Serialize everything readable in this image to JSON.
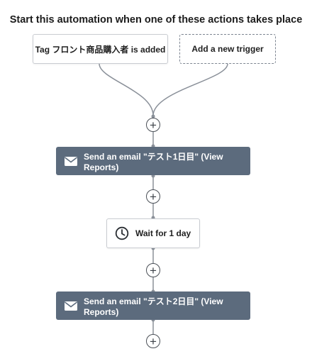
{
  "heading": "Start this automation when one of these actions takes place",
  "triggers": {
    "existing_label": "Tag フロント商品購入者 is added",
    "add_label": "Add a new trigger"
  },
  "steps": [
    {
      "type": "email",
      "icon": "envelope-icon",
      "label": "Send an email \"テスト1日目\" (View Reports)"
    },
    {
      "type": "wait",
      "icon": "clock-icon",
      "label": "Wait for 1 day"
    },
    {
      "type": "email",
      "icon": "envelope-icon",
      "label": "Send an email \"テスト2日目\" (View Reports)"
    }
  ],
  "add_step_symbol": "+",
  "colors": {
    "email_step_bg": "#5c6b7d",
    "connector": "#8a9099",
    "heading_text": "#1c1c1c"
  }
}
